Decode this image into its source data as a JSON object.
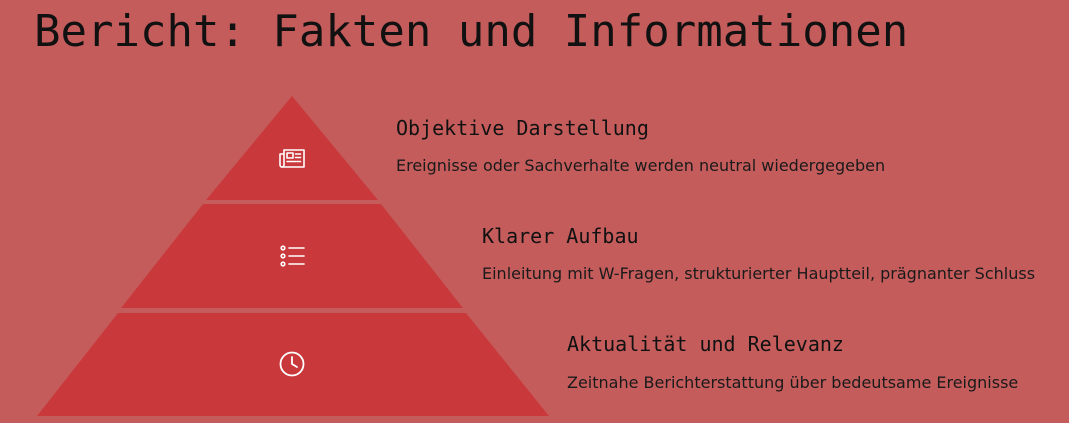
{
  "title": "Bericht: Fakten und Informationen",
  "colors": {
    "background": "#c55c5c",
    "pyramid": "#c9393b",
    "icon": "#ffffff",
    "text": "#111111"
  },
  "levels": [
    {
      "heading": "Objektive Darstellung",
      "description": "Ereignisse oder Sachverhalte werden neutral wiedergegeben",
      "icon": "newspaper-icon"
    },
    {
      "heading": "Klarer Aufbau",
      "description": "Einleitung mit W-Fragen, strukturierter Hauptteil, prägnanter Schluss",
      "icon": "list-icon"
    },
    {
      "heading": "Aktualität und Relevanz",
      "description": "Zeitnahe Berichterstattung über bedeutsame Ereignisse",
      "icon": "clock-icon"
    }
  ]
}
